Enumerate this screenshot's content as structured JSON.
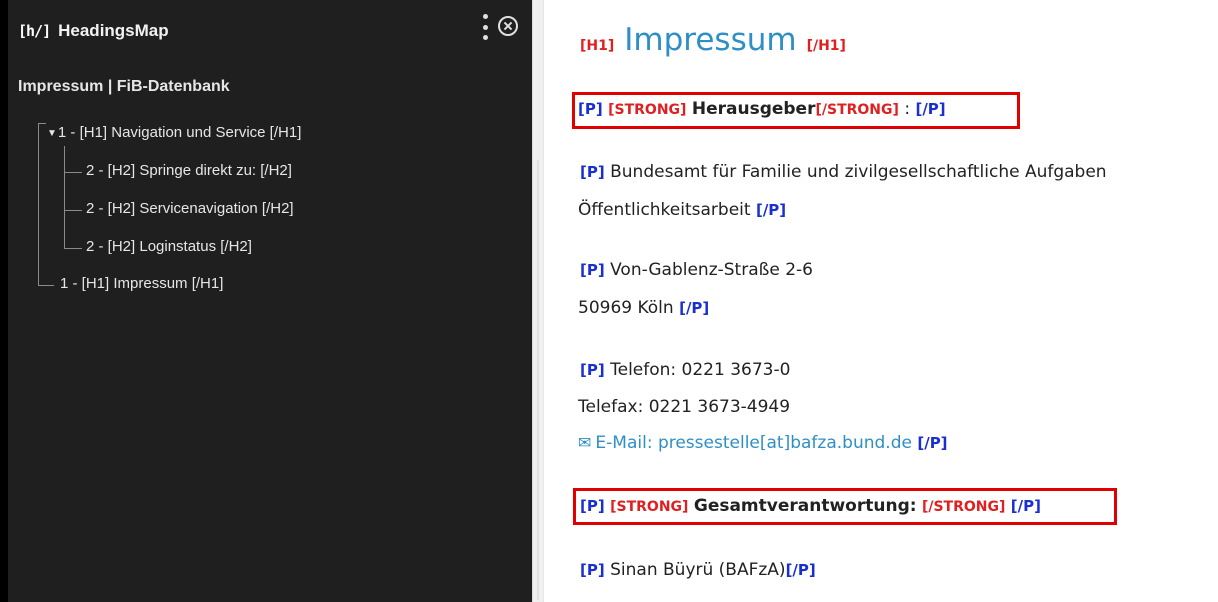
{
  "sidebar": {
    "logo": "[h/]",
    "title": "HeadingsMap",
    "page_title": "Impressum | FiB-Datenbank",
    "tree": [
      {
        "toggle": "▼",
        "text": "1 -  [H1] Navigation und Service [/H1]"
      },
      {
        "text": "2 -  [H2] Springe direkt zu: [/H2]"
      },
      {
        "text": "2 -  [H2] Servicenavigation [/H2]"
      },
      {
        "text": "2 -  [H2] Loginstatus [/H2]"
      },
      {
        "text": "1 -  [H1] Impressum [/H1]"
      }
    ]
  },
  "main": {
    "h1": {
      "open": "[H1]",
      "text": "Impressum",
      "close": "[/H1]"
    },
    "p1": {
      "p_open": "[P]",
      "strong_open": "[STRONG]",
      "strong_text": "Herausgeber",
      "strong_close": "[/STRONG]",
      "suffix": " :",
      "p_close": "[/P]"
    },
    "p2": {
      "p_open": "[P]",
      "line1": "Bundesamt für Familie und zivilgesellschaftliche Aufgaben",
      "line2": "Öffentlichkeitsarbeit",
      "p_close": "[/P]"
    },
    "p3": {
      "p_open": "[P]",
      "line1": "Von-Gablenz-Straße 2-6",
      "line2": "50969 Köln",
      "p_close": "[/P]"
    },
    "p4": {
      "p_open": "[P]",
      "line1": "Telefon: 0221 3673-0",
      "line2": "Telefax: 0221 3673-4949",
      "email": "E-Mail: pressestelle[at]bafza.bund.de",
      "p_close": "[/P]"
    },
    "p5": {
      "p_open": "[P]",
      "strong_open": "[STRONG]",
      "strong_text": "Gesamtverantwortung:",
      "strong_close": "[/STRONG]",
      "p_close": "[/P]"
    },
    "p6": {
      "p_open": "[P]",
      "text": "Sinan Büyrü (BAFzA)",
      "p_close": "[/P]"
    }
  },
  "colors": {
    "sidebar_bg": "#1f1f1f",
    "tag_red": "#e02020",
    "tag_blue": "#1a2fd0",
    "link_blue": "#2e8fc6",
    "highlight_red": "#e00000"
  }
}
